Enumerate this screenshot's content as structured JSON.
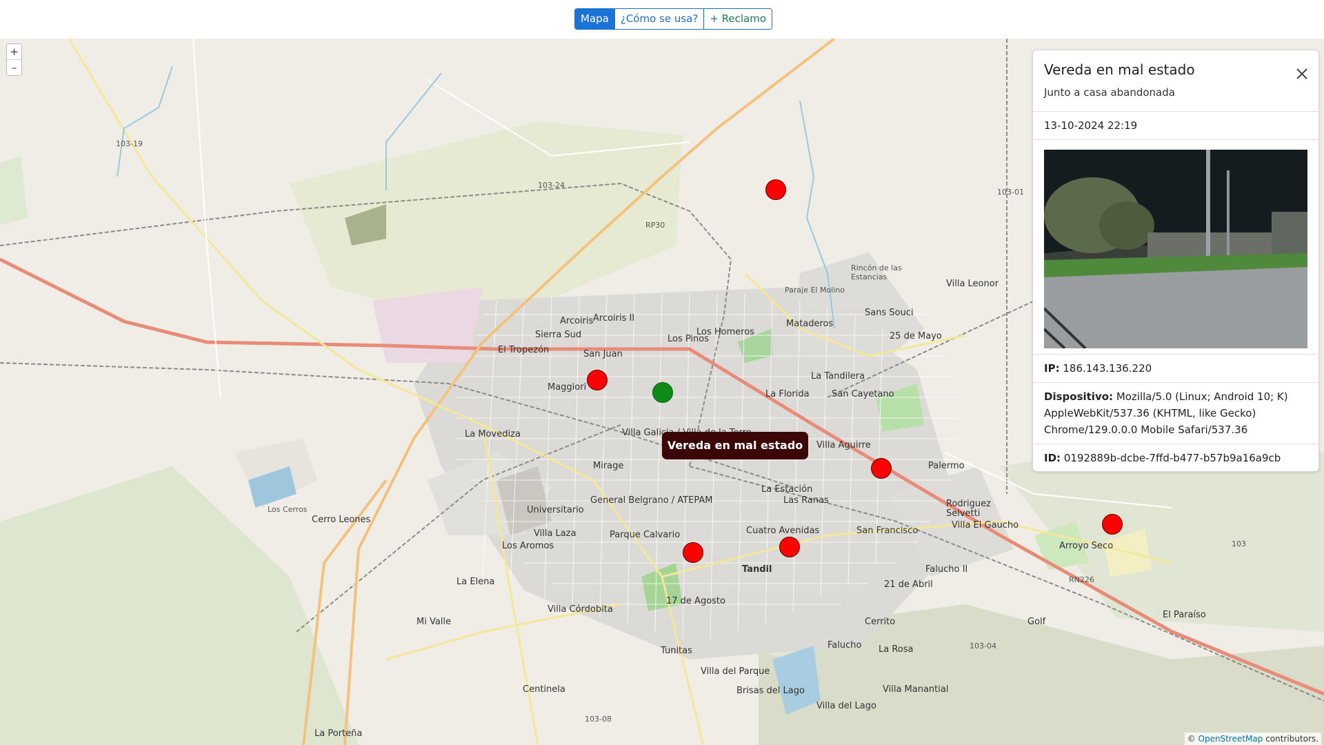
{
  "nav": {
    "tabs": [
      {
        "label": "Mapa"
      },
      {
        "label": "¿Cómo se usa?"
      },
      {
        "label": "+ Reclamo"
      }
    ]
  },
  "map": {
    "zoom_in": "+",
    "zoom_out": "–",
    "tooltip": "Vereda en mal estado",
    "attribution_prefix": "©",
    "attribution_link": "OpenStreetMap",
    "attribution_suffix": "contributors.",
    "labels": [
      "Arcoiris",
      "Arcoiris II",
      "Sierra Sud",
      "El Tropezón",
      "San Juan",
      "Los Pinos",
      "Maggiori",
      "Villa Galicia / Villa de la Torre",
      "La Movediza",
      "Mirage",
      "General Belgrano / ATEPAM",
      "Universitario",
      "Villa Laza",
      "Parque Calvario",
      "Los Aromos",
      "La Elena",
      "Villa Córdobita",
      "Mi Valle",
      "Tunitas",
      "17 de Agosto",
      "Tandil",
      "Villa del Parque",
      "Brisas del Lago",
      "Villa del Lago",
      "Centinela",
      "La Porteña",
      "Cuatro Avenidas",
      "Las Ranas",
      "La Estación",
      "San Francisco",
      "21 de Abril",
      "Cerrito",
      "Falucho",
      "La Rosa",
      "Villa Manantial",
      "Falucho II",
      "Palermo",
      "Rodriguez Selvetti",
      "Villa El Gaucho",
      "Arroyo Seco",
      "El Paraíso",
      "Golf",
      "Villa Aguirre",
      "La Florida",
      "San Cayetano",
      "La Tandilera",
      "Mataderos",
      "Los Homeros",
      "Sans Souci",
      "25 de Mayo",
      "Villa Leonor",
      "Rincón de las Estancias",
      "Paraje El Molino",
      "Cerro Leones",
      "Los Cerros"
    ],
    "route_labels": [
      "103-19",
      "103-24",
      "RP30",
      "103-01",
      "103-04",
      "103-08",
      "RN226",
      "103"
    ]
  },
  "panel": {
    "title": "Vereda en mal estado",
    "subtitle": "Junto a casa abandonada",
    "datetime": "13-10-2024 22:19",
    "ip_label": "IP:",
    "ip_value": "186.143.136.220",
    "device_label": "Dispositivo:",
    "device_value": "Mozilla/5.0 (Linux; Android 10; K) AppleWebKit/537.36 (KHTML, like Gecko) Chrome/129.0.0.0 Mobile Safari/537.36",
    "id_label": "ID:",
    "id_value": "0192889b-dcbe-7ffd-b477-b57b9a16a9cb"
  },
  "colors": {
    "pin_red": "#ff0000",
    "pin_green": "#0e8a16",
    "tooltip_bg": "#3d0606",
    "accent": "#1a73d9"
  }
}
